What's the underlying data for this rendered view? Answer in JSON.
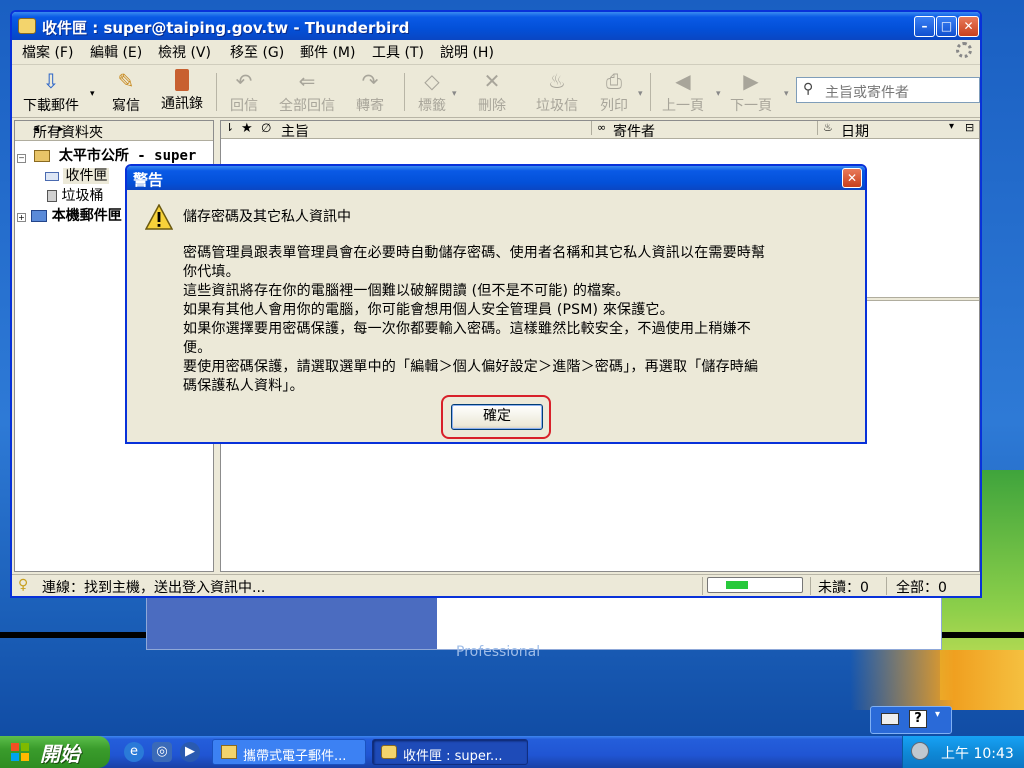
{
  "window": {
    "title": "收件匣 : super@taiping.gov.tw - Thunderbird",
    "min_glyph": "–",
    "max_glyph": "□",
    "close_glyph": "✕"
  },
  "menubar": [
    "檔案 (F)",
    "編輯 (E)",
    "檢視 (V)",
    "移至 (G)",
    "郵件 (M)",
    "工具 (T)",
    "說明 (H)"
  ],
  "toolbar": {
    "get_mail": "下載郵件",
    "write": "寫信",
    "address_book": "通訊錄",
    "reply": "回信",
    "reply_all": "全部回信",
    "forward": "轉寄",
    "tag": "標籤",
    "delete": "刪除",
    "junk": "垃圾信",
    "print": "列印",
    "prev": "上一頁",
    "next": "下一頁",
    "search_placeholder": "主旨或寄件者"
  },
  "folder_pane": {
    "header": "所有資料夾",
    "nav": "◂ ▸",
    "account": "太平市公所  - super",
    "inbox": "收件匣",
    "trash": "垃圾桶",
    "local": "本機郵件匣"
  },
  "columns": {
    "subject": "主旨",
    "sender": "寄件者",
    "date": "日期"
  },
  "status": {
    "text": "連線：找到主機，送出登入資訊中...",
    "unread": "未讀：0",
    "total": "全部：0",
    "progress": 0.25
  },
  "dialog": {
    "title": "警告",
    "close_glyph": "✕",
    "heading": "儲存密碼及其它私人資訊中",
    "lines": [
      "密碼管理員跟表單管理員會在必要時自動儲存密碼、使用者名稱和其它私人資訊以在需要時幫",
      "你代填。",
      "這些資訊將存在你的電腦裡一個難以破解閱讀 (但不是不可能) 的檔案。",
      "如果有其他人會用你的電腦，你可能會想用個人安全管理員 (PSM) 來保護它。",
      "如果你選擇要用密碼保護，每一次你都要輸入密碼。這樣雖然比較安全，不過使用上稍嫌不",
      "便。",
      "要使用密碼保護，請選取選單中的「編輯＞個人偏好設定＞進階＞密碼」，再選取「儲存時編",
      "碼保護私人資料」。"
    ],
    "ok": "確定"
  },
  "desktop": {
    "background_text": "Professional"
  },
  "taskbar": {
    "start": "開始",
    "tasks": [
      "攜帶式電子郵件...",
      "收件匣 : super..."
    ],
    "clock": "上午 10:43"
  }
}
